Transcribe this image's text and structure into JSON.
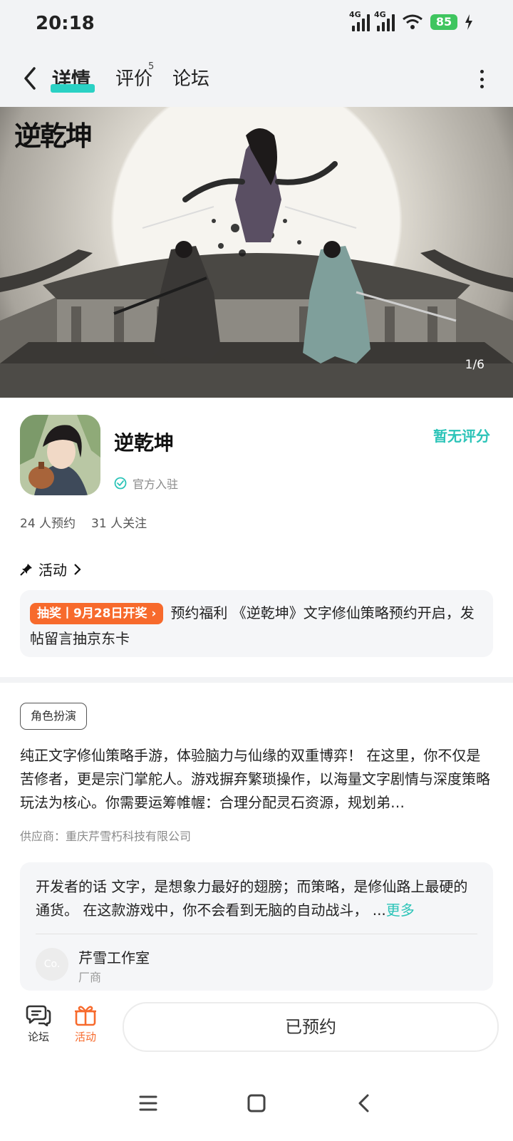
{
  "status_bar": {
    "time": "20:18",
    "net1": "4G",
    "net2": "4G",
    "battery": "85"
  },
  "nav": {
    "tabs": [
      {
        "label": "详情",
        "active": true
      },
      {
        "label": "评价",
        "superscript": "5"
      },
      {
        "label": "论坛"
      }
    ]
  },
  "banner": {
    "logo_text": "逆乾坤",
    "counter": "1/6"
  },
  "app": {
    "name": "逆乾坤",
    "official_label": "官方入驻",
    "rating_note": "暂无评分",
    "reservations": "24 人预约",
    "followers": "31 人关注"
  },
  "activity": {
    "header": "活动",
    "badge": "抽奖丨9月28日开奖",
    "text": "预约福利 《逆乾坤》文字修仙策略预约开启，发帖留言抽京东卡"
  },
  "details": {
    "genre_tag": "角色扮演",
    "description": "纯正文字修仙策略手游，体验脑力与仙缘的双重博弈！ 在这里，你不仅是苦修者，更是宗门掌舵人。游戏摒弃繁琐操作，以海量文字剧情与深度策略玩法为核心。你需要运筹帷幄：合理分配灵石资源，规划弟…",
    "supplier": "供应商：重庆芹雪朽科技有限公司"
  },
  "developer": {
    "text": "开发者的话  文字，是想象力最好的翅膀；而策略，是修仙路上最硬的通货。 在这款游戏中，你不会看到无脑的自动战斗，  ...",
    "more": "更多",
    "avatar_text": "Co.",
    "name": "芹雪工作室",
    "role": "厂商"
  },
  "bottom_bar": {
    "forum_label": "论坛",
    "activity_label": "活动",
    "reserve_label": "已预约"
  },
  "colors": {
    "accent": "#2cc4b8",
    "orange": "#f76a2c",
    "underline": "#2ad1c4",
    "battery": "#3fc55f"
  }
}
